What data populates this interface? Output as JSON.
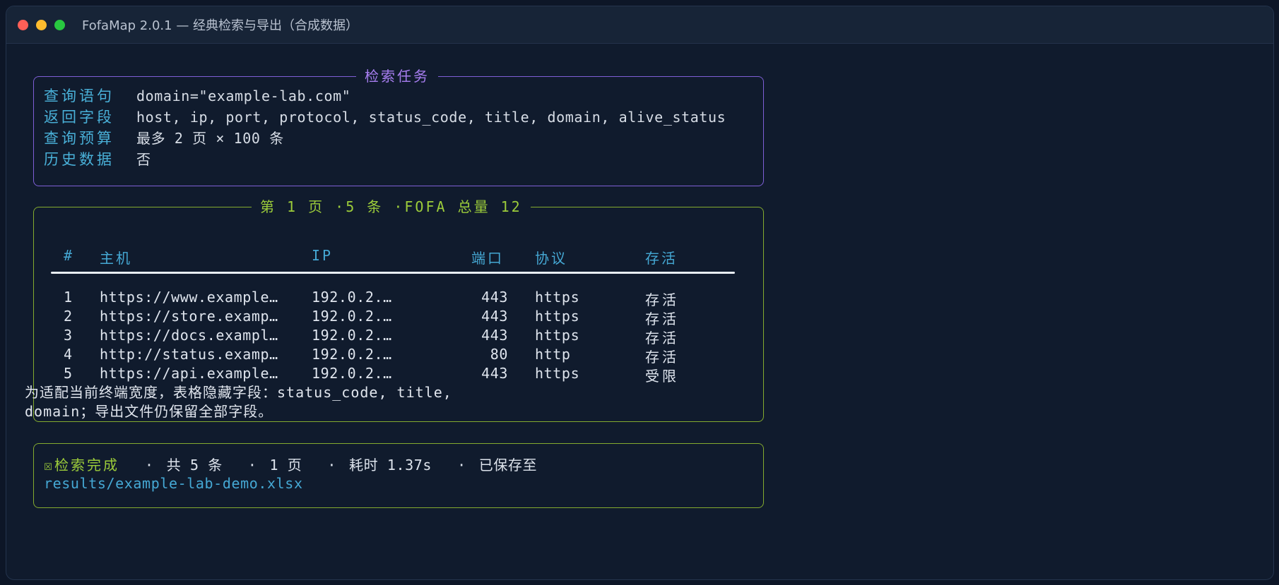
{
  "window": {
    "title": "FofaMap 2.0.1 — 经典检索与导出（合成数据）"
  },
  "task_panel": {
    "title": "检索任务",
    "rows": [
      {
        "key": "查询语句",
        "value": "domain=\"example-lab.com\""
      },
      {
        "key": "返回字段",
        "value": "host, ip, port, protocol, status_code, title, domain, alive_status"
      },
      {
        "key": "查询预算",
        "value": "最多 2 页 × 100 条"
      },
      {
        "key": "历史数据",
        "value": "否"
      }
    ]
  },
  "results_panel": {
    "title": "第 1 页 ·5 条 ·FOFA 总量 12",
    "headers": [
      "#",
      "主机",
      "IP",
      "端口",
      "协议",
      "存活"
    ],
    "rows": [
      [
        "1",
        "https://www.example…",
        "192.0.2.…",
        "443",
        "https",
        "存活"
      ],
      [
        "2",
        "https://store.examp…",
        "192.0.2.…",
        "443",
        "https",
        "存活"
      ],
      [
        "3",
        "https://docs.exampl…",
        "192.0.2.…",
        "443",
        "https",
        "存活"
      ],
      [
        "4",
        "http://status.examp…",
        "192.0.2.…",
        "80",
        "http",
        "存活"
      ],
      [
        "5",
        "https://api.example…",
        "192.0.2.…",
        "443",
        "https",
        "受限"
      ]
    ]
  },
  "note": {
    "line1": "为适配当前终端宽度，表格隐藏字段：status_code, title,",
    "line2": "domain；导出文件仍保留全部字段。"
  },
  "done_panel": {
    "status": "☒检索完成",
    "sep": "·",
    "total": "共 5 条",
    "pages": "1 页",
    "elapsed": "耗时 1.37s",
    "saved": "已保存至",
    "path": "results/example-lab-demo.xlsx"
  },
  "colors": {
    "background": "#101b2d",
    "accent_purple": "#a77ef0",
    "accent_green": "#9ccc3a",
    "accent_cyan": "#45a8d4",
    "text": "#dfe5ee"
  }
}
